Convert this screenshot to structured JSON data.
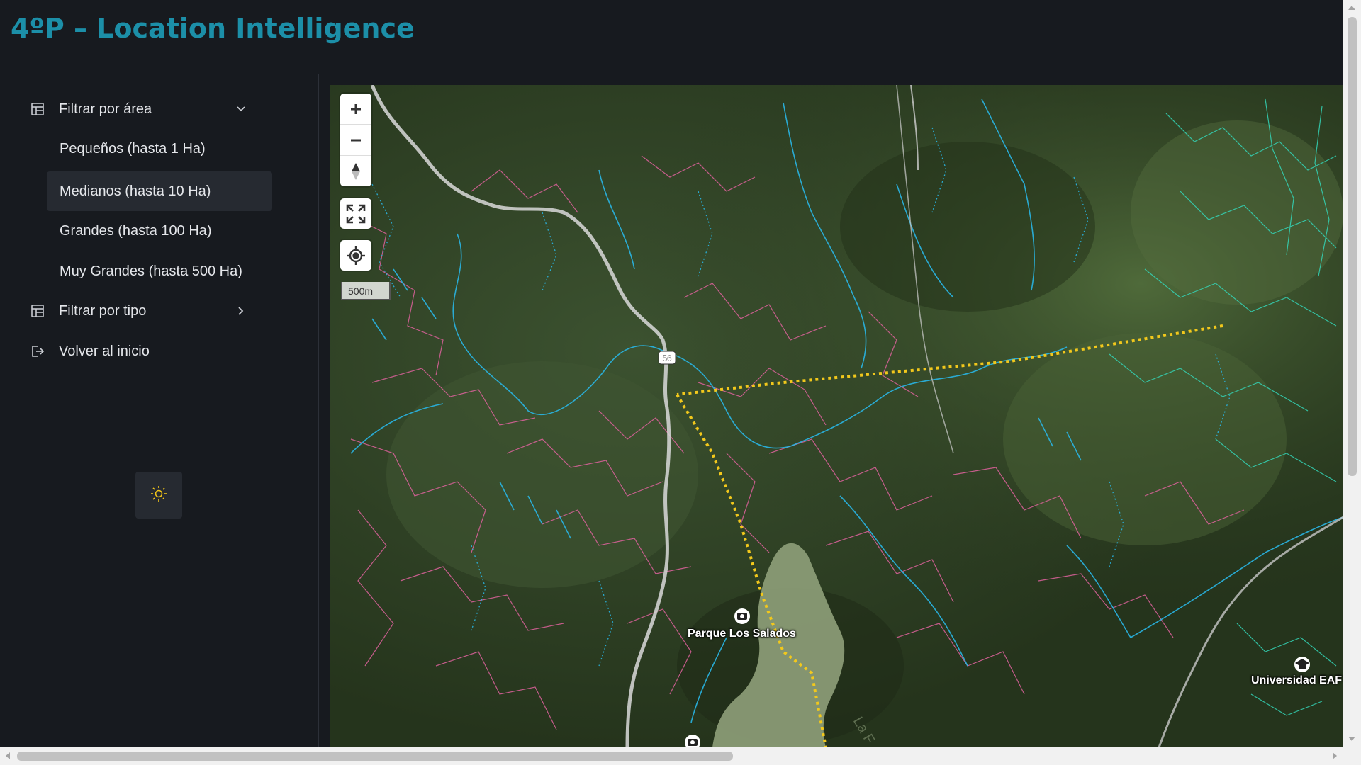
{
  "app": {
    "title": "4ºP – Location Intelligence"
  },
  "sidebar": {
    "area_filter": {
      "label": "Filtrar por área",
      "expanded": true,
      "options": [
        {
          "label": "Pequeños (hasta 1 Ha)",
          "selected": false
        },
        {
          "label": "Medianos (hasta 10 Ha)",
          "selected": true
        },
        {
          "label": "Grandes (hasta 100 Ha)",
          "selected": false
        },
        {
          "label": "Muy Grandes (hasta 500 Ha)",
          "selected": false
        }
      ]
    },
    "type_filter": {
      "label": "Filtrar por tipo",
      "expanded": false
    },
    "home": {
      "label": "Volver al inicio"
    },
    "theme_toggle": {
      "icon": "sun-icon",
      "color": "#f0c419"
    }
  },
  "map": {
    "scale_label": "500m",
    "road_shield": "56",
    "labels": {
      "park": "Parque Los Salados",
      "university": "Universidad EAF",
      "lake": "La F"
    },
    "colors": {
      "streams": "#29b6e6",
      "parcels": "#e0629e",
      "eastern_parcels": "#34d6b8",
      "boundary": "#f2c81c",
      "road": "#c8c8c8",
      "water": "#8fa07a"
    },
    "controls": [
      "zoom-in",
      "zoom-out",
      "compass",
      "fullscreen",
      "geolocate"
    ]
  },
  "theme": {
    "accent": "#1c8fa8",
    "background": "#171a1f",
    "selected": "#262a31"
  }
}
